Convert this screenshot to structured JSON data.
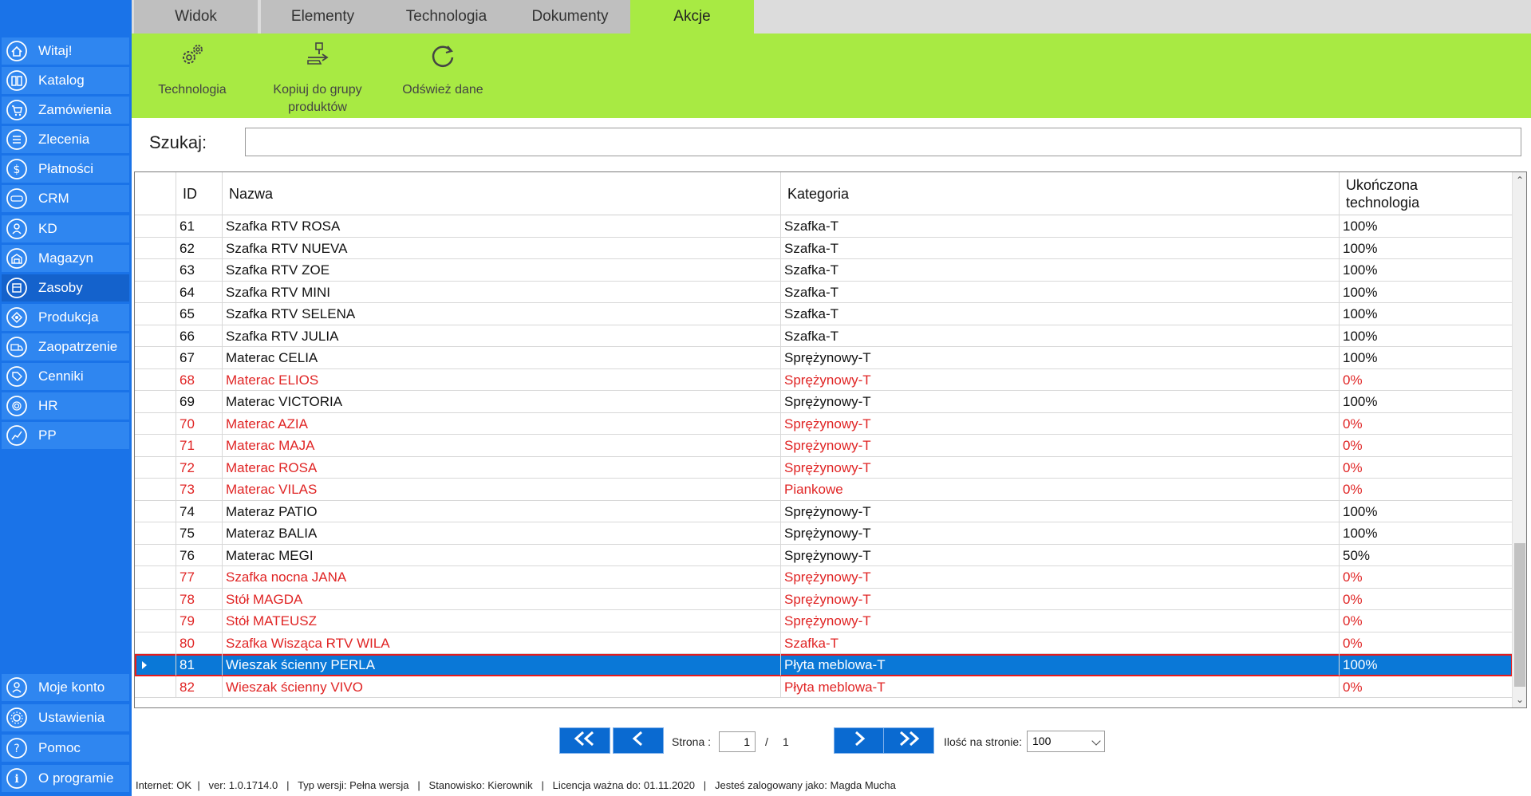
{
  "sidebar": {
    "items": [
      {
        "label": "Witaj!",
        "icon": "home-icon"
      },
      {
        "label": "Katalog",
        "icon": "book-icon"
      },
      {
        "label": "Zamówienia",
        "icon": "cart-icon"
      },
      {
        "label": "Zlecenia",
        "icon": "list-icon"
      },
      {
        "label": "Płatności",
        "icon": "dollar-icon"
      },
      {
        "label": "CRM",
        "icon": "crm-icon"
      },
      {
        "label": "KD",
        "icon": "person-icon"
      },
      {
        "label": "Magazyn",
        "icon": "warehouse-icon"
      },
      {
        "label": "Zasoby",
        "icon": "box-icon"
      },
      {
        "label": "Produkcja",
        "icon": "production-icon"
      },
      {
        "label": "Zaopatrzenie",
        "icon": "truck-icon"
      },
      {
        "label": "Cenniki",
        "icon": "tag-icon"
      },
      {
        "label": "HR",
        "icon": "fingerprint-icon"
      },
      {
        "label": "PP",
        "icon": "chart-icon"
      }
    ],
    "bottom_items": [
      {
        "label": "Moje konto",
        "icon": "account-icon"
      },
      {
        "label": "Ustawienia",
        "icon": "gear-icon"
      },
      {
        "label": "Pomoc",
        "icon": "question-icon"
      },
      {
        "label": "O programie",
        "icon": "info-icon"
      }
    ]
  },
  "tabs": [
    {
      "label": "Widok"
    },
    {
      "label": "Elementy"
    },
    {
      "label": "Technologia"
    },
    {
      "label": "Dokumenty"
    },
    {
      "label": "Akcje"
    }
  ],
  "ribbon": {
    "technologia": "Technologia",
    "kopiuj_line1": "Kopiuj do grupy",
    "kopiuj_line2": "produktów",
    "odswiez": "Odśwież dane"
  },
  "search": {
    "label": "Szukaj:",
    "value": ""
  },
  "grid": {
    "headers": {
      "id": "ID",
      "name": "Nazwa",
      "category": "Kategoria",
      "completed_line1": "Ukończona",
      "completed_line2": "technologia"
    },
    "rows": [
      {
        "id": "61",
        "name": "Szafka RTV ROSA",
        "category": "Szafka-T",
        "pct": "100%",
        "red": false
      },
      {
        "id": "62",
        "name": "Szafka RTV NUEVA",
        "category": "Szafka-T",
        "pct": "100%",
        "red": false
      },
      {
        "id": "63",
        "name": "Szafka RTV ZOE",
        "category": "Szafka-T",
        "pct": "100%",
        "red": false
      },
      {
        "id": "64",
        "name": "Szafka RTV MINI",
        "category": "Szafka-T",
        "pct": "100%",
        "red": false
      },
      {
        "id": "65",
        "name": "Szafka RTV SELENA",
        "category": "Szafka-T",
        "pct": "100%",
        "red": false
      },
      {
        "id": "66",
        "name": "Szafka RTV JULIA",
        "category": "Szafka-T",
        "pct": "100%",
        "red": false
      },
      {
        "id": "67",
        "name": "Materac CELIA",
        "category": "Sprężynowy-T",
        "pct": "100%",
        "red": false
      },
      {
        "id": "68",
        "name": "Materac ELIOS",
        "category": "Sprężynowy-T",
        "pct": "0%",
        "red": true
      },
      {
        "id": "69",
        "name": "Materac VICTORIA",
        "category": "Sprężynowy-T",
        "pct": "100%",
        "red": false
      },
      {
        "id": "70",
        "name": "Materac AZIA",
        "category": "Sprężynowy-T",
        "pct": "0%",
        "red": true
      },
      {
        "id": "71",
        "name": "Materac MAJA",
        "category": "Sprężynowy-T",
        "pct": "0%",
        "red": true
      },
      {
        "id": "72",
        "name": "Materac ROSA",
        "category": "Sprężynowy-T",
        "pct": "0%",
        "red": true
      },
      {
        "id": "73",
        "name": "Materac VILAS",
        "category": "Piankowe",
        "pct": "0%",
        "red": true
      },
      {
        "id": "74",
        "name": "Materaz PATIO",
        "category": "Sprężynowy-T",
        "pct": "100%",
        "red": false
      },
      {
        "id": "75",
        "name": "Materaz BALIA",
        "category": "Sprężynowy-T",
        "pct": "100%",
        "red": false
      },
      {
        "id": "76",
        "name": "Materac MEGI",
        "category": "Sprężynowy-T",
        "pct": "50%",
        "red": false
      },
      {
        "id": "77",
        "name": "Szafka nocna JANA",
        "category": "Sprężynowy-T",
        "pct": "0%",
        "red": true
      },
      {
        "id": "78",
        "name": "Stół MAGDA",
        "category": "Sprężynowy-T",
        "pct": "0%",
        "red": true
      },
      {
        "id": "79",
        "name": "Stół MATEUSZ",
        "category": "Sprężynowy-T",
        "pct": "0%",
        "red": true
      },
      {
        "id": "80",
        "name": "Szafka Wisząca RTV WILA",
        "category": "Szafka-T",
        "pct": "0%",
        "red": true
      },
      {
        "id": "81",
        "name": "Wieszak ścienny PERLA",
        "category": "Płyta meblowa-T",
        "pct": "100%",
        "red": false,
        "selected": true
      },
      {
        "id": "82",
        "name": "Wieszak ścienny VIVO",
        "category": "Płyta meblowa-T",
        "pct": "0%",
        "red": true
      }
    ]
  },
  "pager": {
    "label": "Strona :",
    "current": "1",
    "separator": "/",
    "total": "1",
    "per_page_label": "Ilość na stronie:",
    "per_page": "100"
  },
  "status": {
    "text": "Internet: OK  |   ver: 1.0.1714.0   |   Typ wersji: Pełna wersja   |   Stanowisko: Kierownik   |   Licencja ważna do: 01.11.2020   |   Jesteś zalogowany jako: Magda Mucha"
  },
  "colors": {
    "sidebar": "#1a73e8",
    "ribbon": "#a8ea43",
    "selected_row": "#0a78d7",
    "red_text": "#e02424"
  }
}
